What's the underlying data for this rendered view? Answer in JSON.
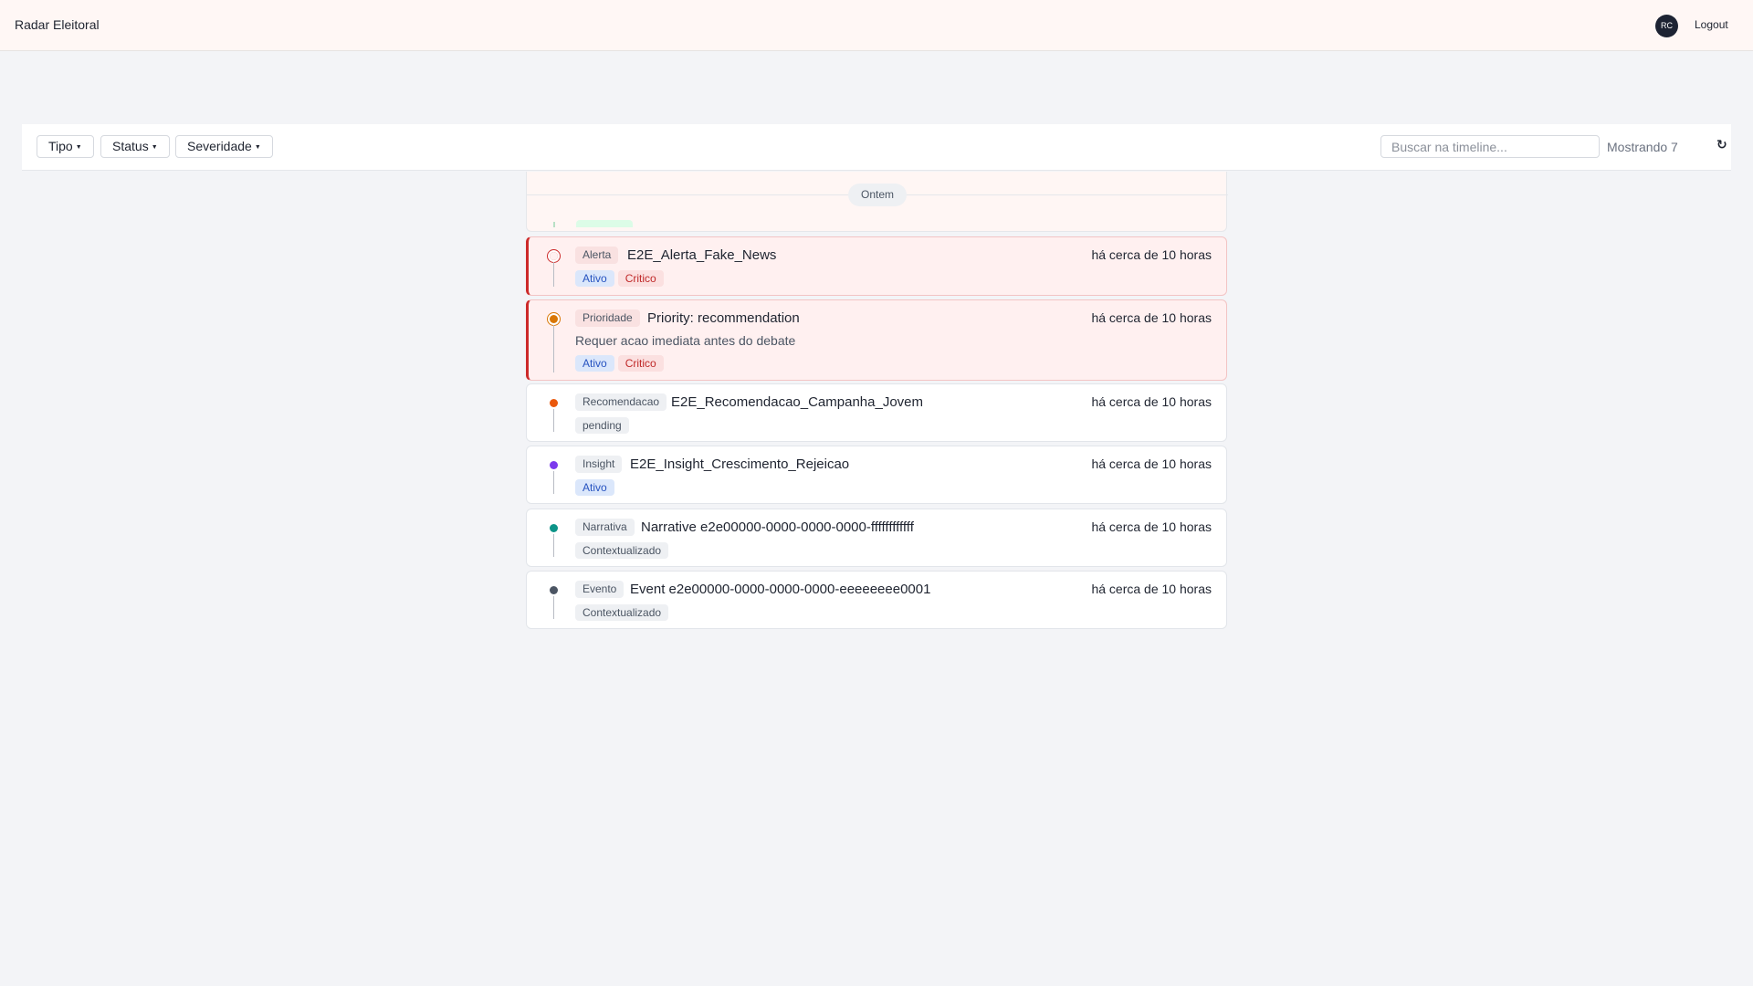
{
  "header": {
    "app_title": "Radar Eleitoral",
    "avatar_initials": "RC",
    "logout_label": "Logout"
  },
  "filters": {
    "tipo_label": "Tipo",
    "status_label": "Status",
    "severidade_label": "Severidade",
    "search_placeholder": "Buscar na timeline...",
    "showing_label": "Mostrando 7",
    "refresh_icon": "↻"
  },
  "timeline": {
    "day_label": "Ontem",
    "items": [
      {
        "type": "Alerta",
        "title": "E2E_Alerta_Fake_News",
        "time": "há cerca de 10 horas",
        "description": "",
        "tags": [
          "Ativo",
          "Critico"
        ],
        "dot_color": "#cc2a2a",
        "critical": true
      },
      {
        "type": "Prioridade",
        "title": "Priority: recommendation",
        "time": "há cerca de 10 horas",
        "description": "Requer acao imediata antes do debate",
        "tags": [
          "Ativo",
          "Critico"
        ],
        "dot_color": "#d97706",
        "critical": true
      },
      {
        "type": "Recomendacao",
        "title": "E2E_Recomendacao_Campanha_Jovem",
        "time": "há cerca de 10 horas",
        "description": "",
        "tags": [
          "pending"
        ],
        "dot_color": "#ea580c",
        "critical": false
      },
      {
        "type": "Insight",
        "title": "E2E_Insight_Crescimento_Rejeicao",
        "time": "há cerca de 10 horas",
        "description": "",
        "tags": [
          "Ativo"
        ],
        "dot_color": "#7c3aed",
        "critical": false
      },
      {
        "type": "Narrativa",
        "title": "Narrative e2e00000-0000-0000-0000-ffffffffffff",
        "time": "há cerca de 10 horas",
        "description": "",
        "tags": [
          "Contextualizado"
        ],
        "dot_color": "#0d9488",
        "critical": false
      },
      {
        "type": "Evento",
        "title": "Event e2e00000-0000-0000-0000-eeeeeeee0001",
        "time": "há cerca de 10 horas",
        "description": "",
        "tags": [
          "Contextualizado"
        ],
        "dot_color": "#4b5563",
        "critical": false
      }
    ]
  }
}
